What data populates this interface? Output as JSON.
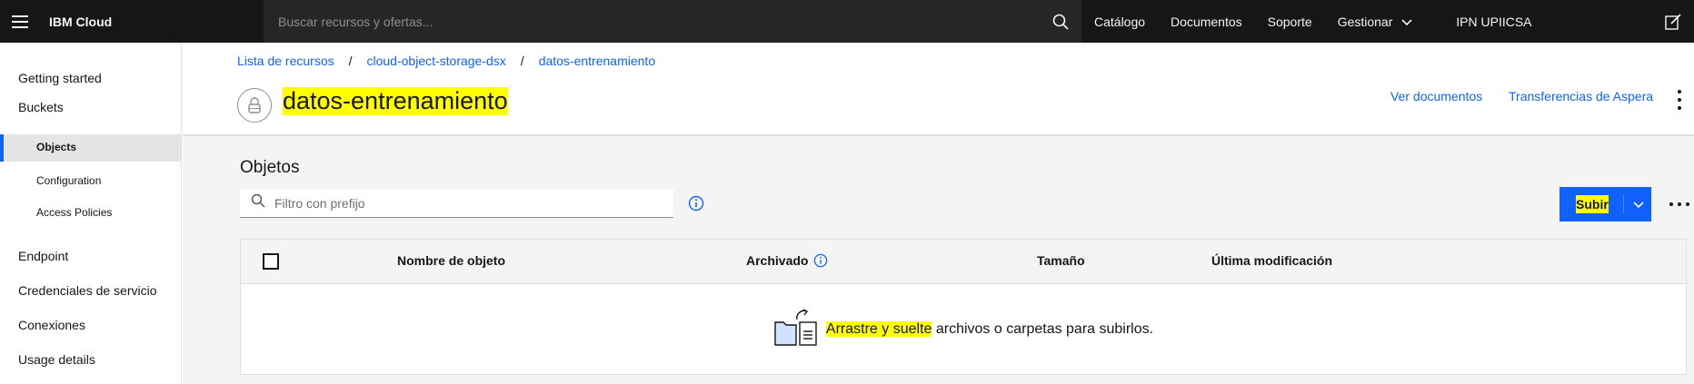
{
  "topbar": {
    "brand": "IBM Cloud",
    "search_placeholder": "Buscar recursos y ofertas...",
    "nav": {
      "catalog": "Catálogo",
      "docs": "Documentos",
      "support": "Soporte",
      "manage": "Gestionar",
      "account": "IPN UPIICSA"
    }
  },
  "sidebar": {
    "getting_started": "Getting started",
    "buckets": "Buckets",
    "objects": "Objects",
    "configuration": "Configuration",
    "access_policies": "Access Policies",
    "endpoint": "Endpoint",
    "credentials": "Credenciales de servicio",
    "connections": "Conexiones",
    "usage": "Usage details"
  },
  "header": {
    "breadcrumb": [
      "Lista de recursos",
      "cloud-object-storage-dsx",
      "datos-entrenamiento"
    ],
    "breadcrumb_sep": "/",
    "title": "datos-entrenamiento",
    "view_docs": "Ver documentos",
    "aspera": "Transferencias de Aspera"
  },
  "main": {
    "section_title": "Objetos",
    "filter_placeholder": "Filtro con prefijo",
    "upload_label": "Subir",
    "table": {
      "columns": {
        "name": "Nombre de objeto",
        "archived": "Archivado",
        "size": "Tamaño",
        "modified": "Última modificación"
      },
      "empty_highlight": "Arrastre y suelte",
      "empty_rest": " archivos o carpetas para subirlos."
    }
  },
  "colors": {
    "topbar_bg": "#161616",
    "accent": "#0f62fe",
    "highlight": "#ffff00",
    "content_bg": "#f4f4f4"
  }
}
